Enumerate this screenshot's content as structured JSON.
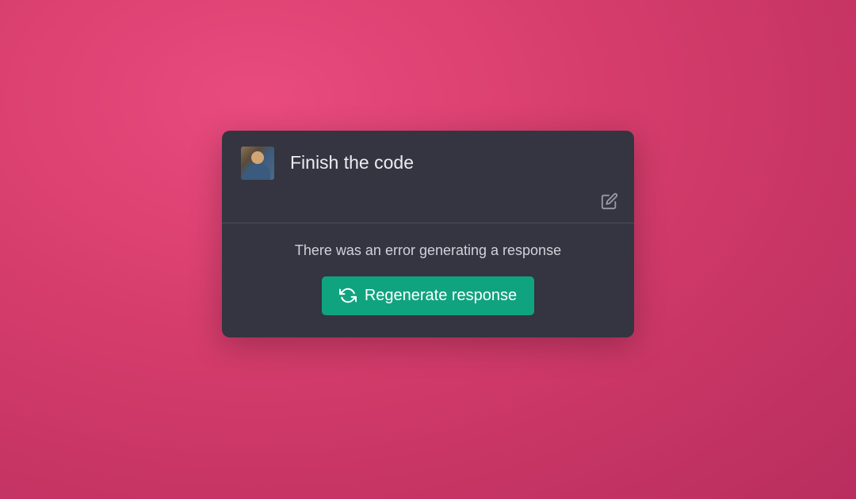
{
  "message": {
    "text": "Finish the code"
  },
  "error": {
    "text": "There was an error generating a response"
  },
  "button": {
    "regenerate_label": "Regenerate response"
  },
  "colors": {
    "card_bg": "#343541",
    "accent": "#10a37f",
    "text_primary": "#ececf1",
    "text_secondary": "#d1d1d9"
  }
}
